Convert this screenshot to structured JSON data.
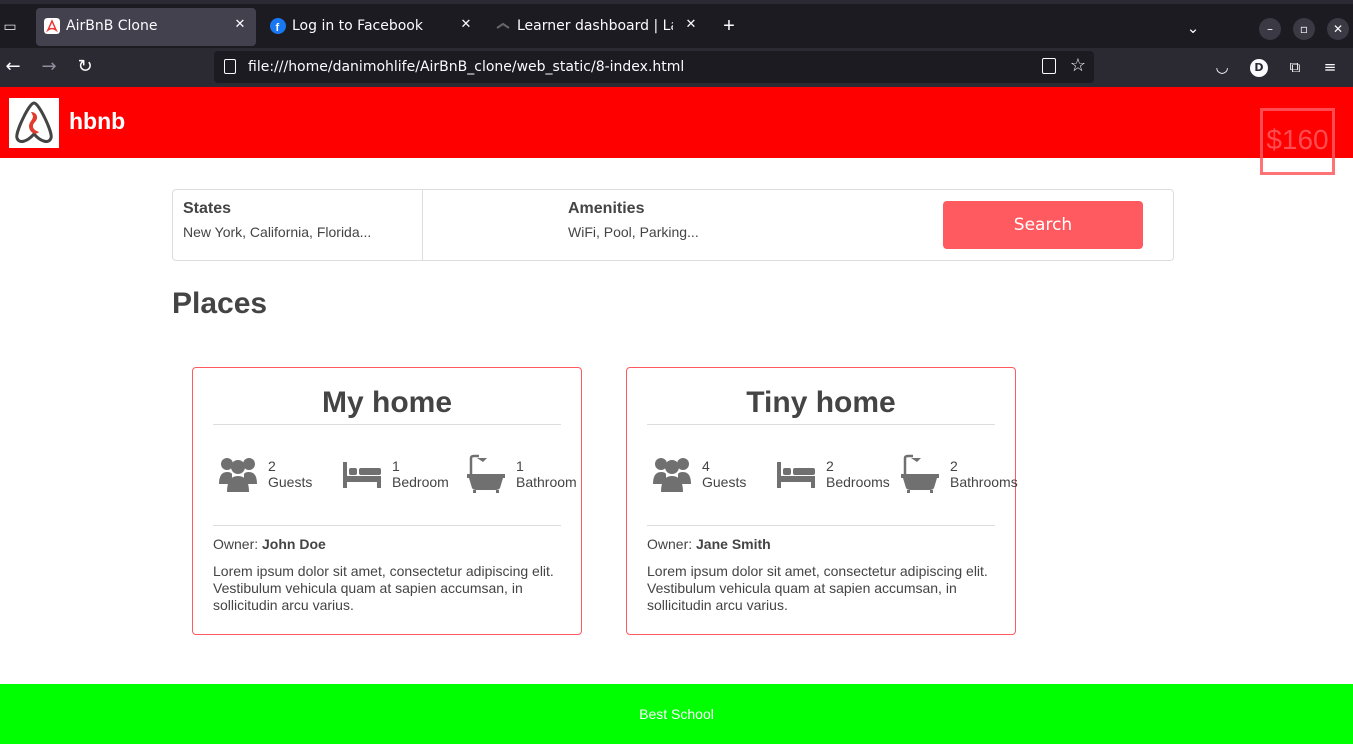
{
  "browser": {
    "tabs": [
      {
        "title": "AirBnB Clone",
        "active": true
      },
      {
        "title": "Log in to Facebook",
        "active": false
      },
      {
        "title": "Learner dashboard | Lago",
        "active": false
      }
    ],
    "url": "file:///home/danimohlife/AirBnB_clone/web_static/8-index.html",
    "account_initial": "D"
  },
  "header": {
    "brand": "hbnb",
    "price_badge": "$160"
  },
  "filters": {
    "states_title": "States",
    "states_value": "New York, California, Florida...",
    "amenities_title": "Amenities",
    "amenities_value": "WiFi, Pool, Parking...",
    "search_label": "Search"
  },
  "places": {
    "title": "Places",
    "items": [
      {
        "name": "My home",
        "guests_num": "2",
        "guests_label": "Guests",
        "rooms_num": "1",
        "rooms_label": "Bedroom",
        "baths_num": "1",
        "baths_label": "Bathroom",
        "owner_prefix": "Owner:",
        "owner_name": "John Doe",
        "description": "Lorem ipsum dolor sit amet, consectetur adipiscing elit. Vestibulum vehicula quam at sapien accumsan, in sollicitudin arcu varius."
      },
      {
        "name": "Tiny home",
        "guests_num": "4",
        "guests_label": "Guests",
        "rooms_num": "2",
        "rooms_label": "Bedrooms",
        "baths_num": "2",
        "baths_label": "Bathrooms",
        "owner_prefix": "Owner:",
        "owner_name": "Jane Smith",
        "description": "Lorem ipsum dolor sit amet, consectetur adipiscing elit. Vestibulum vehicula quam at sapien accumsan, in sollicitudin arcu varius."
      }
    ]
  },
  "footer": {
    "text": "Best School"
  },
  "colors": {
    "header_bg": "#ff0000",
    "accent": "#ff5a5f",
    "footer_bg": "#00ff00"
  }
}
